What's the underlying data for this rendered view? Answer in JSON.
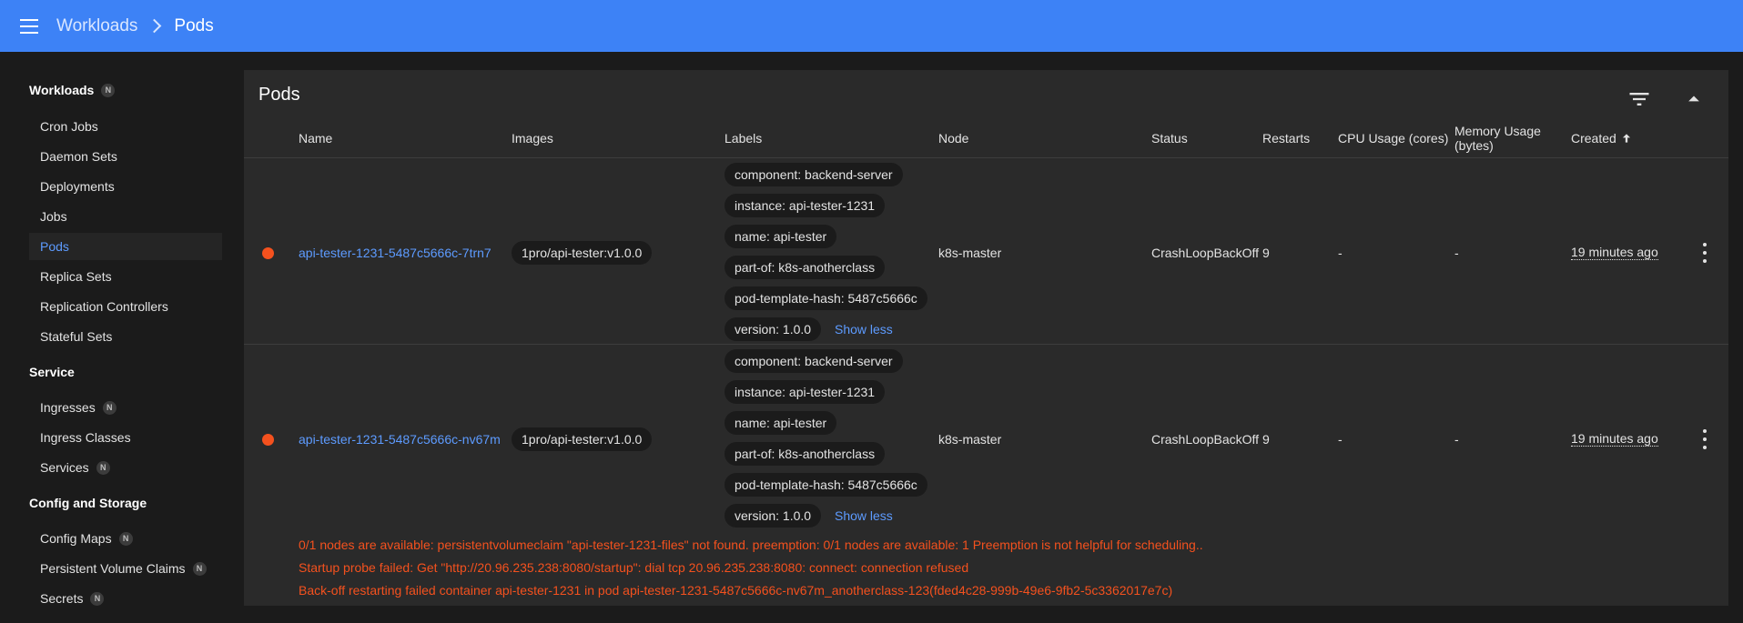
{
  "header": {
    "menu_icon": "menu-icon",
    "breadcrumb_parent": "Workloads",
    "breadcrumb_current": "Pods"
  },
  "sidebar": {
    "groups": [
      {
        "label": "Workloads",
        "badge": "N"
      },
      {
        "label": "Service"
      },
      {
        "label": "Config and Storage"
      }
    ],
    "workloads": [
      "Cron Jobs",
      "Daemon Sets",
      "Deployments",
      "Jobs",
      "Pods",
      "Replica Sets",
      "Replication Controllers",
      "Stateful Sets"
    ],
    "service": [
      {
        "label": "Ingresses",
        "badge": "N"
      },
      {
        "label": "Ingress Classes"
      },
      {
        "label": "Services",
        "badge": "N"
      }
    ],
    "config": [
      {
        "label": "Config Maps",
        "badge": "N"
      },
      {
        "label": "Persistent Volume Claims",
        "badge": "N"
      },
      {
        "label": "Secrets",
        "badge": "N"
      }
    ],
    "active_item": "Pods"
  },
  "card": {
    "title": "Pods",
    "icons": {
      "filter": "filter-icon",
      "collapse": "arrow-up-icon"
    },
    "columns": [
      "Name",
      "Images",
      "Labels",
      "Node",
      "Status",
      "Restarts",
      "CPU Usage (cores)",
      "Memory Usage (bytes)",
      "Created"
    ],
    "columns_wrapped": {
      "memory_line1": "Memory Usage",
      "memory_line2": "(bytes)"
    },
    "sort_indicator": "arrow-up-icon"
  },
  "rows": [
    {
      "status_color": "#f4511e",
      "name": "api-tester-1231-5487c5666c-7trn7",
      "image": "1pro/api-tester:v1.0.0",
      "labels": [
        "component: backend-server",
        "instance: api-tester-1231",
        "name: api-tester",
        "part-of: k8s-anotherclass",
        "pod-template-hash: 5487c5666c",
        "version: 1.0.0"
      ],
      "show_less": "Show less",
      "node": "k8s-master",
      "status": "CrashLoopBackOff",
      "restarts": "9",
      "cpu": "-",
      "memory": "-",
      "created": "19 minutes ago"
    },
    {
      "status_color": "#f4511e",
      "name": "api-tester-1231-5487c5666c-nv67m",
      "image": "1pro/api-tester:v1.0.0",
      "labels": [
        "component: backend-server",
        "instance: api-tester-1231",
        "name: api-tester",
        "part-of: k8s-anotherclass",
        "pod-template-hash: 5487c5666c",
        "version: 1.0.0"
      ],
      "show_less": "Show less",
      "node": "k8s-master",
      "status": "CrashLoopBackOff",
      "restarts": "9",
      "cpu": "-",
      "memory": "-",
      "created": "19 minutes ago",
      "errors": [
        "0/1 nodes are available: persistentvolumeclaim \"api-tester-1231-files\" not found. preemption: 0/1 nodes are available: 1 Preemption is not helpful for scheduling..",
        "Startup probe failed: Get \"http://20.96.235.238:8080/startup\": dial tcp 20.96.235.238:8080: connect: connection refused",
        "Back-off restarting failed container api-tester-1231 in pod api-tester-1231-5487c5666c-nv67m_anotherclass-123(fded4c28-999b-49e6-9fb2-5c3362017e7c)"
      ]
    }
  ]
}
